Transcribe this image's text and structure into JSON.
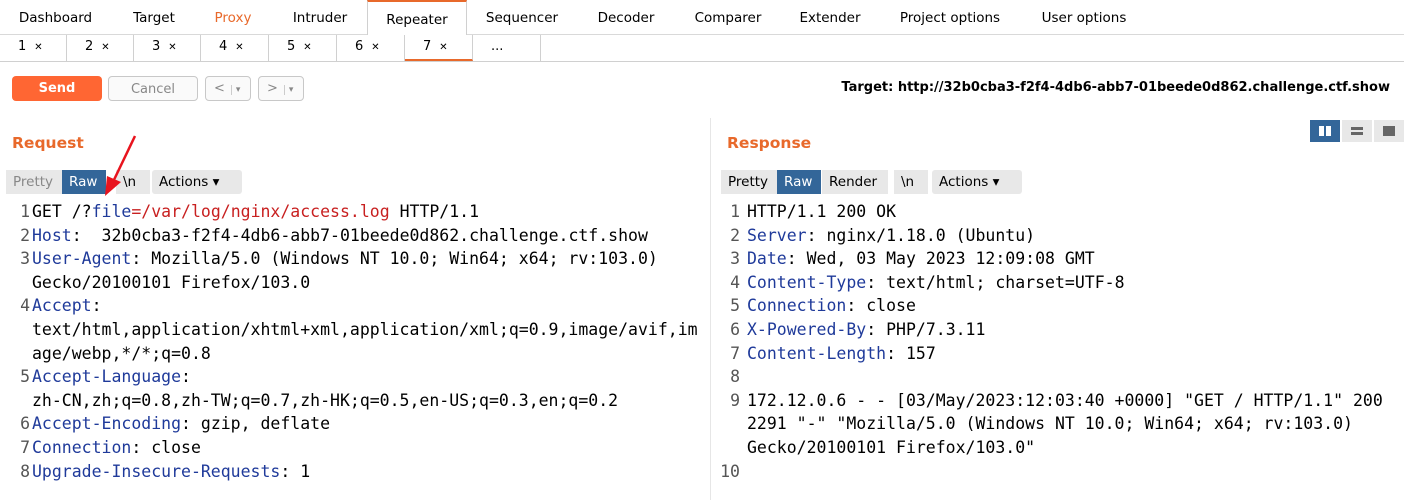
{
  "main_tabs": [
    "Dashboard",
    "Target",
    "Proxy",
    "Intruder",
    "Repeater",
    "Sequencer",
    "Decoder",
    "Comparer",
    "Extender",
    "Project options",
    "User options"
  ],
  "sub_tabs": [
    "1",
    "2",
    "3",
    "4",
    "5",
    "6",
    "7",
    "..."
  ],
  "toolbar": {
    "send_label": "Send",
    "cancel_label": "Cancel",
    "back_label": "<",
    "fwd_label": ">",
    "dropdown_glyph": "▾",
    "target_text": "Target: http://32b0cba3-f2f4-4db6-abb7-01beede0d862.challenge.ctf.show"
  },
  "request": {
    "title": "Request",
    "buttons": {
      "pretty": "Pretty",
      "raw": "Raw",
      "newline": "\\n",
      "actions": "Actions"
    },
    "lines": [
      {
        "num": "1",
        "parts": [
          [
            "GET /?",
            ""
          ],
          [
            "file",
            "blue"
          ],
          [
            "=/var/log/nginx/access.log",
            "red"
          ],
          [
            " HTTP/1.1",
            ""
          ]
        ]
      },
      {
        "num": "2",
        "parts": [
          [
            "Host",
            "blue"
          ],
          [
            ":  32b0cba3-f2f4-4db6-abb7-01beede0d862.challenge.ctf.show",
            ""
          ]
        ]
      },
      {
        "num": "3",
        "parts": [
          [
            "User-Agent",
            "blue"
          ],
          [
            ": Mozilla/5.0 (Windows NT 10.0; Win64; x64; rv:103.0)",
            ""
          ]
        ]
      },
      {
        "num": "",
        "parts": [
          [
            "Gecko/20100101 Firefox/103.0",
            ""
          ]
        ]
      },
      {
        "num": "4",
        "parts": [
          [
            "Accept",
            "blue"
          ],
          [
            ":",
            ""
          ]
        ]
      },
      {
        "num": "",
        "parts": [
          [
            "text/html,application/xhtml+xml,application/xml;q=0.9,image/avif,im",
            ""
          ]
        ]
      },
      {
        "num": "",
        "parts": [
          [
            "age/webp,*/*;q=0.8",
            ""
          ]
        ]
      },
      {
        "num": "5",
        "parts": [
          [
            "Accept-Language",
            "blue"
          ],
          [
            ":",
            ""
          ]
        ]
      },
      {
        "num": "",
        "parts": [
          [
            "zh-CN,zh;q=0.8,zh-TW;q=0.7,zh-HK;q=0.5,en-US;q=0.3,en;q=0.2",
            ""
          ]
        ]
      },
      {
        "num": "6",
        "parts": [
          [
            "Accept-Encoding",
            "blue"
          ],
          [
            ": gzip, deflate",
            ""
          ]
        ]
      },
      {
        "num": "7",
        "parts": [
          [
            "Connection",
            "blue"
          ],
          [
            ": close",
            ""
          ]
        ]
      },
      {
        "num": "8",
        "parts": [
          [
            "Upgrade-Insecure-Requests",
            "blue"
          ],
          [
            ": 1",
            ""
          ]
        ]
      }
    ]
  },
  "response": {
    "title": "Response",
    "buttons": {
      "pretty": "Pretty",
      "raw": "Raw",
      "render": "Render",
      "newline": "\\n",
      "actions": "Actions"
    },
    "lines": [
      {
        "num": "1",
        "parts": [
          [
            "HTTP/1.1 200 OK",
            ""
          ]
        ]
      },
      {
        "num": "2",
        "parts": [
          [
            "Server",
            "blue"
          ],
          [
            ": nginx/1.18.0 (Ubuntu)",
            ""
          ]
        ]
      },
      {
        "num": "3",
        "parts": [
          [
            "Date",
            "blue"
          ],
          [
            ": Wed, 03 May 2023 12:09:08 GMT",
            ""
          ]
        ]
      },
      {
        "num": "4",
        "parts": [
          [
            "Content-Type",
            "blue"
          ],
          [
            ": text/html; charset=UTF-8",
            ""
          ]
        ]
      },
      {
        "num": "5",
        "parts": [
          [
            "Connection",
            "blue"
          ],
          [
            ": close",
            ""
          ]
        ]
      },
      {
        "num": "6",
        "parts": [
          [
            "X-Powered-By",
            "blue"
          ],
          [
            ": PHP/7.3.11",
            ""
          ]
        ]
      },
      {
        "num": "7",
        "parts": [
          [
            "Content-Length",
            "blue"
          ],
          [
            ": 157",
            ""
          ]
        ]
      },
      {
        "num": "8",
        "parts": [
          [
            "",
            ""
          ]
        ]
      },
      {
        "num": "9",
        "parts": [
          [
            "172.12.0.6 - - [03/May/2023:12:03:40 +0000] \"GET / HTTP/1.1\" 200",
            ""
          ]
        ]
      },
      {
        "num": "",
        "parts": [
          [
            "2291 \"-\" \"Mozilla/5.0 (Windows NT 10.0; Win64; x64; rv:103.0)",
            ""
          ]
        ]
      },
      {
        "num": "",
        "parts": [
          [
            "Gecko/20100101 Firefox/103.0\"",
            ""
          ]
        ]
      },
      {
        "num": "10",
        "parts": [
          [
            "",
            ""
          ]
        ]
      }
    ]
  },
  "colors": {
    "accent": "#e8692b",
    "raw_active": "#336699",
    "header_key": "#1f3a9a",
    "param_value": "#c82020"
  }
}
